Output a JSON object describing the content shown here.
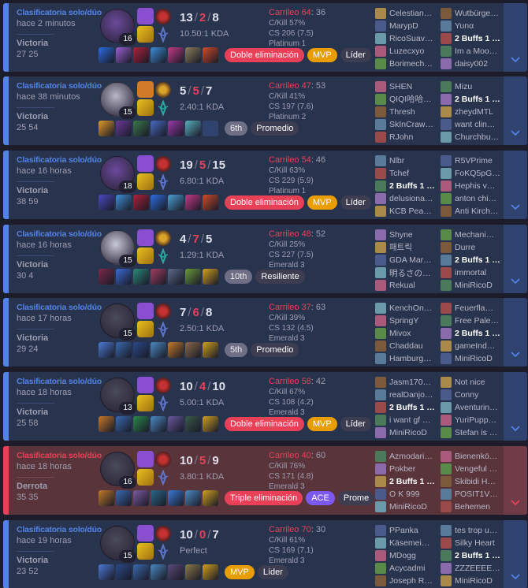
{
  "matches": [
    {
      "result_type": "win",
      "queue": "Clasificatoria solo/dúo",
      "ago": "hace 2 minutos",
      "result": "Victoria",
      "duration": "27 25",
      "level": "16",
      "champ_color": "#6b4a9c",
      "spells": [
        "#8a4ed0",
        "#d42a2a"
      ],
      "rune": "#c63232",
      "rune2_color": "#5e74c9",
      "kills": "13",
      "deaths": "2",
      "assists": "8",
      "kda": "10.50:1 KDA",
      "items": [
        "#2c6ee0",
        "#9a5fd1",
        "#b0203a",
        "#3f8dd6",
        "#c43a88",
        "#8b7d5a",
        "#d14a2a"
      ],
      "empty_item": false,
      "badges": [
        {
          "label": "Doble eliminación",
          "cls": "b-red"
        },
        {
          "label": "MVP",
          "cls": "b-mvp"
        },
        {
          "label": "Líder",
          "cls": "b-gray"
        }
      ],
      "cs_label": "Carrileo 64",
      "cs_rest": ": 36",
      "ckill": "C/Kill 57%",
      "cs": "CS 206 (7.5)",
      "rank": "Platinum 1",
      "team1": [
        "Celestian…",
        "MarypD",
        "RicoSuav…",
        "Luzecxyo",
        "Borimech…"
      ],
      "team2": [
        "Wutbürge…",
        "Yunα",
        "2 Buffs 1 …",
        "Im a Moo…",
        "daisy002"
      ],
      "me_team": 2,
      "me_idx": 2
    },
    {
      "result_type": "win",
      "queue": "Clasificatoria solo/dúo",
      "ago": "hace 38 minutos",
      "result": "Victoria",
      "duration": "25 54",
      "level": "15",
      "champ_color": "#b9b7c8",
      "spells": [
        "#d07a2a",
        "#c97a1a"
      ],
      "rune": "#dba42a",
      "rune2_color": "#2aa8a0",
      "kills": "5",
      "deaths": "5",
      "assists": "7",
      "kda": "2.40:1 KDA",
      "items": [
        "#e09a2a",
        "#6a3a9a",
        "#3a7a4a",
        "#4a6ac2",
        "#9a3aaa",
        "#5ab0c0"
      ],
      "empty_item": true,
      "badges": [
        {
          "label": "6th",
          "cls": "b-lgray"
        },
        {
          "label": "Promedio",
          "cls": "b-gray"
        }
      ],
      "cs_label": "Carrileo 47",
      "cs_rest": ": 53",
      "ckill": "C/Kill 41%",
      "cs": "CS 197 (7.6)",
      "rank": "Platinum 2",
      "team1": [
        "SHEN",
        "QIQI哈哈…",
        "Thresh",
        "SkInCraw…",
        "RJohn"
      ],
      "team2": [
        "Mizu",
        "2 Buffs 1 …",
        "zheydMTL",
        "want clin…",
        "Churchbu…"
      ],
      "me_team": 2,
      "me_idx": 1
    },
    {
      "result_type": "win",
      "queue": "Clasificatoria solo/dúo",
      "ago": "hace 16 horas",
      "result": "Victoria",
      "duration": "38 59",
      "level": "18",
      "champ_color": "#6b4a9c",
      "spells": [
        "#8a4ed0",
        "#d42a2a"
      ],
      "rune": "#c63232",
      "rune2_color": "#5e74c9",
      "kills": "19",
      "deaths": "5",
      "assists": "15",
      "kda": "6.80:1 KDA",
      "items": [
        "#4a4ac2",
        "#3f8dd6",
        "#b0203a",
        "#2c6ee0",
        "#4aa0d6",
        "#c43a88",
        "#d14a2a"
      ],
      "empty_item": false,
      "badges": [
        {
          "label": "Doble eliminación",
          "cls": "b-red"
        },
        {
          "label": "MVP",
          "cls": "b-mvp"
        },
        {
          "label": "Líder",
          "cls": "b-gray"
        }
      ],
      "cs_label": "Carrileo 54",
      "cs_rest": ": 46",
      "ckill": "C/Kill 63%",
      "cs": "CS 229 (5.9)",
      "rank": "Platinum 1",
      "team1": [
        "Nlbr",
        "Tchef",
        "2 Buffs 1 …",
        "delusiona…",
        "KCB Pea…"
      ],
      "team2": [
        "R5VPrime",
        "FoKQ5pG…",
        "Hephis v…",
        "anton chi…",
        "Anti Kirch…"
      ],
      "me_team": 1,
      "me_idx": 2
    },
    {
      "result_type": "win",
      "queue": "Clasificatoria solo/dúo",
      "ago": "hace 16 horas",
      "result": "Victoria",
      "duration": "30 4",
      "level": "15",
      "champ_color": "#c9c9d9",
      "spells": [
        "#8a4ed0",
        "#d07a2a"
      ],
      "rune": "#dba42a",
      "rune2_color": "#2aa8a0",
      "kills": "4",
      "deaths": "7",
      "assists": "5",
      "kda": "1.29:1 KDA",
      "items": [
        "#7a2a4a",
        "#3a6ad6",
        "#2a8a7a",
        "#a04060",
        "#5a6a8a",
        "#6a9a3a",
        "#d0a020"
      ],
      "empty_item": false,
      "badges": [
        {
          "label": "10th",
          "cls": "b-lgray"
        },
        {
          "label": "Resiliente",
          "cls": "b-gray"
        }
      ],
      "cs_label": "Carrileo 48",
      "cs_rest": ": 52",
      "ckill": "C/Kill 25%",
      "cs": "CS 227 (7.5)",
      "rank": "Emerald 3",
      "team1": [
        "Shyne",
        "패트릭",
        "GDA Mar…",
        "明るさの…",
        "Rekual"
      ],
      "team2": [
        "Mechani…",
        "Durre",
        "2 Buffs 1 …",
        "immortal",
        "MiniRicoD"
      ],
      "me_team": 2,
      "me_idx": 2
    },
    {
      "result_type": "win",
      "queue": "Clasificatoria solo/dúo",
      "ago": "hace 17 horas",
      "result": "Victoria",
      "duration": "29 24",
      "level": "15",
      "champ_color": "#4a4a58",
      "spells": [
        "#8a4ed0",
        "#d42a2a"
      ],
      "rune": "#c63232",
      "rune2_color": "#5e74c9",
      "kills": "7",
      "deaths": "6",
      "assists": "8",
      "kda": "2.50:1 KDA",
      "items": [
        "#4a7ad6",
        "#3a6ab0",
        "#2a4a8a",
        "#4a8ac2",
        "#c47a2a",
        "#8a6a4a",
        "#d0a020"
      ],
      "empty_item": false,
      "badges": [
        {
          "label": "5th",
          "cls": "b-lgray"
        },
        {
          "label": "Promedio",
          "cls": "b-gray"
        }
      ],
      "cs_label": "Carrileo 37",
      "cs_rest": ": 63",
      "ckill": "C/Kill 39%",
      "cs": "CS 132 (4.5)",
      "rank": "Emerald 3",
      "team1": [
        "KenchOn…",
        "SpringY",
        "Mivox",
        "Chaddau",
        "Hamburg…"
      ],
      "team2": [
        "Feuerfla…",
        "Free Pale…",
        "2 Buffs 1 …",
        "gameInd…",
        "MiniRicoD"
      ],
      "me_team": 2,
      "me_idx": 2
    },
    {
      "result_type": "win",
      "queue": "Clasificatoria solo/dúo",
      "ago": "hace 18 horas",
      "result": "Victoria",
      "duration": "25 58",
      "level": "13",
      "champ_color": "#4a4a58",
      "spells": [
        "#8a4ed0",
        "#d42a2a"
      ],
      "rune": "#c63232",
      "rune2_color": "#5e74c9",
      "kills": "10",
      "deaths": "4",
      "assists": "10",
      "kda": "5.00:1 KDA",
      "items": [
        "#c47a2a",
        "#3a6ab0",
        "#2a8a4a",
        "#4a8ac2",
        "#6a5aa0",
        "#3a5a4a",
        "#d0a020"
      ],
      "empty_item": false,
      "badges": [
        {
          "label": "Doble eliminación",
          "cls": "b-red"
        },
        {
          "label": "MVP",
          "cls": "b-mvp"
        },
        {
          "label": "Líder",
          "cls": "b-gray"
        }
      ],
      "cs_label": "Carrileo 58",
      "cs_rest": ": 42",
      "ckill": "C/Kill 67%",
      "cs": "CS 108 (4.2)",
      "rank": "Emerald 3",
      "team1": [
        "Jasm170…",
        "realDanjo…",
        "2 Buffs 1 …",
        "i want gf …",
        "MiniRicoD"
      ],
      "team2": [
        "Not nice",
        "Conny",
        "Aventurin…",
        "YuriPupp…",
        "Stefan is …"
      ],
      "me_team": 1,
      "me_idx": 2
    },
    {
      "result_type": "loss",
      "queue": "Clasificatoria solo/dúo",
      "ago": "hace 18 horas",
      "result": "Derrota",
      "duration": "35 35",
      "level": "16",
      "champ_color": "#4a4a58",
      "spells": [
        "#8a4ed0",
        "#d42a2a"
      ],
      "rune": "#c63232",
      "rune2_color": "#5e74c9",
      "kills": "10",
      "deaths": "5",
      "assists": "9",
      "kda": "3.80:1 KDA",
      "items": [
        "#c47a2a",
        "#3a6ab0",
        "#7a5aa0",
        "#2a6a8a",
        "#3a7ad6",
        "#4a8ac2",
        "#d0a020"
      ],
      "empty_item": false,
      "badges": [
        {
          "label": "Triple eliminación",
          "cls": "b-red"
        },
        {
          "label": "ACE",
          "cls": "b-ace"
        },
        {
          "label": "Prome",
          "cls": "b-gray"
        }
      ],
      "cs_label": "Carrileo 40",
      "cs_rest": ": 60",
      "ckill": "C/Kill 76%",
      "cs": "CS 171 (4.8)",
      "rank": "Emerald 3",
      "team1": [
        "Azmodari…",
        "Pokber",
        "2 Buffs 1 …",
        "O K 999",
        "MiniRicoD"
      ],
      "team2": [
        "Bienenkö…",
        "Vengeful …",
        "Skibidi H…",
        "POSIT1V…",
        "Behemen"
      ],
      "me_team": 1,
      "me_idx": 2
    },
    {
      "result_type": "win",
      "queue": "Clasificatoria solo/dúo",
      "ago": "hace 19 horas",
      "result": "Victoria",
      "duration": "23 52",
      "level": "15",
      "champ_color": "#4a4a58",
      "spells": [
        "#8a4ed0",
        "#d42a2a"
      ],
      "rune": "#c63232",
      "rune2_color": "#5e74c9",
      "kills": "10",
      "deaths": "0",
      "assists": "7",
      "kda": "Perfect",
      "items": [
        "#4a7ad6",
        "#2a4a8a",
        "#3a6ab0",
        "#4a8ac2",
        "#5a4a7a",
        "#8a7a4a",
        "#d0a020"
      ],
      "empty_item": false,
      "badges": [
        {
          "label": "MVP",
          "cls": "b-mvp"
        },
        {
          "label": "Líder",
          "cls": "b-gray"
        }
      ],
      "cs_label": "Carrileo 70",
      "cs_rest": ": 30",
      "ckill": "C/Kill 61%",
      "cs": "CS 169 (7.1)",
      "rank": "Emerald 3",
      "team1": [
        "PPanka",
        "Käsemei…",
        "MDogg",
        "Acycadmi",
        "Joseph R…"
      ],
      "team2": [
        "tes trop u…",
        "Silky Heart",
        "2 Buffs 1 …",
        "ZZZEEEE…",
        "MiniRicoD"
      ],
      "me_team": 2,
      "me_idx": 2
    }
  ]
}
